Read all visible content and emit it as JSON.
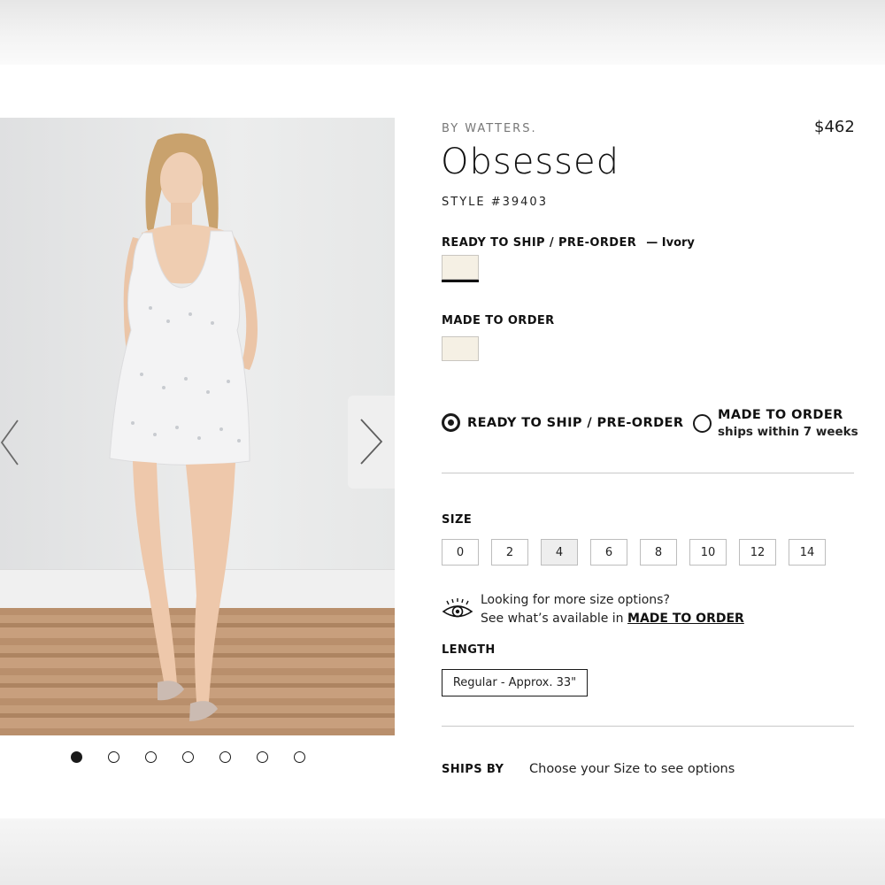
{
  "product": {
    "brand": "BY WATTERS.",
    "price": "$462",
    "title": "Obsessed",
    "style": "STYLE #39403"
  },
  "ready_to_ship": {
    "label": "READY TO SHIP / PRE-ORDER",
    "color_name": "— Ivory",
    "swatch_color": "#f5f0e4"
  },
  "made_to_order": {
    "label": "MADE TO ORDER",
    "swatch_color": "#f5f0e4"
  },
  "shipping_options": [
    {
      "label": "READY TO SHIP / PRE-ORDER",
      "selected": true
    },
    {
      "label": "MADE TO ORDER",
      "sub": "ships within 7 weeks",
      "selected": false
    }
  ],
  "size": {
    "label": "SIZE",
    "options": [
      "0",
      "2",
      "4",
      "6",
      "8",
      "10",
      "12",
      "14"
    ],
    "selected": "4"
  },
  "more_sizes": {
    "line1": "Looking for more size options?",
    "line2_prefix": "See what’s available in",
    "link": "MADE TO ORDER"
  },
  "length": {
    "label": "LENGTH",
    "value": "Regular - Approx. 33\""
  },
  "ships_by": {
    "label": "SHIPS BY",
    "value": "Choose your Size to see options"
  },
  "gallery": {
    "image_count": 7,
    "active_index": 0
  },
  "icons": [
    "chevron-left-icon",
    "chevron-right-icon",
    "eye-icon"
  ]
}
